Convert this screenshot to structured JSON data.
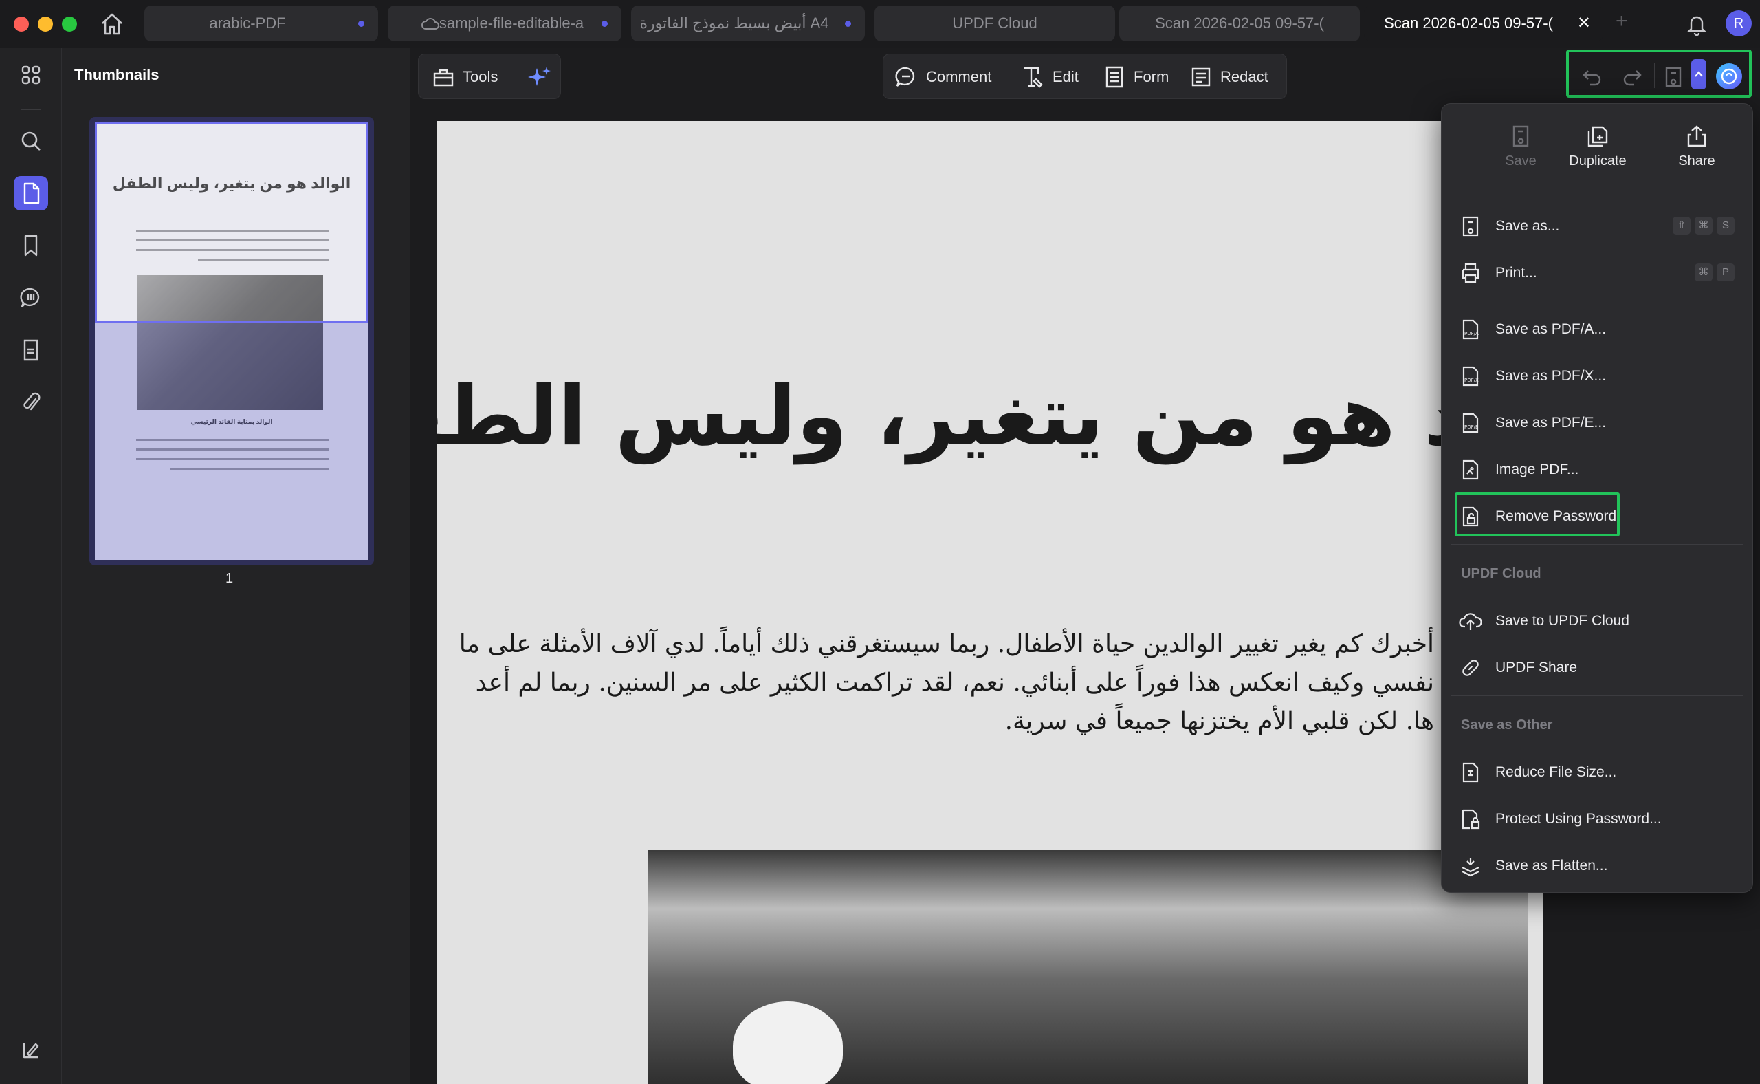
{
  "tabs": [
    {
      "label": "arabic-PDF",
      "dot": true
    },
    {
      "label": "sample-file-editable-a",
      "dot": true,
      "cloud": true
    },
    {
      "label": "A4 أبيض بسيط نموذج الفاتورة",
      "dot": true
    },
    {
      "label": "UPDF Cloud",
      "dot": false
    },
    {
      "label": "Scan 2026-02-05 09-57-(",
      "dot": false
    },
    {
      "label": "Scan 2026-02-05 09-57-(",
      "active": true,
      "close_label": "✕"
    }
  ],
  "new_tab_label": "+",
  "avatar_initial": "R",
  "thumbnails": {
    "title": "Thumbnails",
    "page_number": "1",
    "page_title": "الوالد هو من يتغير، وليس الطفل",
    "caption": "الوالد بمثابة القائد الرئيسي"
  },
  "toolbar": {
    "tools_label": "Tools",
    "comment_label": "Comment",
    "edit_label": "Edit",
    "form_label": "Form",
    "redact_label": "Redact"
  },
  "document": {
    "title": "لد هو من يتغير، وليس الطفل",
    "lines": [
      "أخبرك كم يغير تغيير الوالدين حياة الأطفال. ربما سيستغرقني ذلك أياماً. لدي آلاف الأمثلة على ما",
      "نفسي وكيف انعكس هذا فوراً على أبنائي. نعم، لقد تراكمت الكثير على مر السنين. ربما لم أعد",
      "ها. لكن قلبي الأم يختزنها جميعاً في سرية."
    ]
  },
  "menu": {
    "top": {
      "save": "Save",
      "duplicate": "Duplicate",
      "share": "Share"
    },
    "save_as": {
      "label": "Save as...",
      "keys": [
        "⇧",
        "⌘",
        "S"
      ]
    },
    "print": {
      "label": "Print...",
      "keys": [
        "⌘",
        "P"
      ]
    },
    "pdfa": "Save as PDF/A...",
    "pdfx": "Save as PDF/X...",
    "pdfe": "Save as PDF/E...",
    "image_pdf": "Image PDF...",
    "remove_password": "Remove Password",
    "cloud_section": "UPDF Cloud",
    "save_cloud": "Save to UPDF Cloud",
    "updf_share": "UPDF Share",
    "other_section": "Save as Other",
    "reduce": "Reduce File Size...",
    "protect": "Protect Using Password...",
    "flatten": "Save as Flatten..."
  },
  "colors": {
    "accent": "#5b5de8",
    "highlight_green": "#22c35a",
    "background": "#1c1c1e"
  }
}
